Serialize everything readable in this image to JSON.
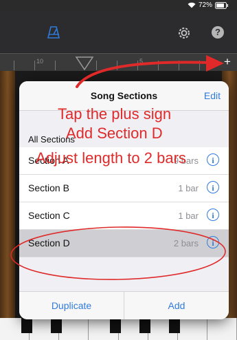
{
  "status_bar": {
    "battery_percent": "72%"
  },
  "toolbar": {
    "icons": [
      "metronome-icon",
      "gear-icon",
      "help-icon"
    ],
    "help_label": "?"
  },
  "ruler": {
    "numbers": [
      "10",
      "5"
    ],
    "plus_label": "+"
  },
  "popover": {
    "title": "Song Sections",
    "edit_label": "Edit",
    "sections_header": "All Sections",
    "rows": [
      {
        "name": "Section A",
        "length": "9 bars",
        "selected": false
      },
      {
        "name": "Section B",
        "length": "1 bar",
        "selected": false
      },
      {
        "name": "Section C",
        "length": "1 bar",
        "selected": false
      },
      {
        "name": "Section D",
        "length": "2 bars",
        "selected": true
      }
    ],
    "info_glyph": "i",
    "duplicate_label": "Duplicate",
    "add_label": "Add"
  },
  "annotations": {
    "line1": "Tap the plus sign",
    "line2": "Add Section D",
    "line3": "Adjust length to 2 bars",
    "color": "#e02a2a"
  },
  "colors": {
    "accent": "#2f7bdc",
    "selected_row": "#cfcfd3",
    "annotation": "#e02a2a"
  }
}
